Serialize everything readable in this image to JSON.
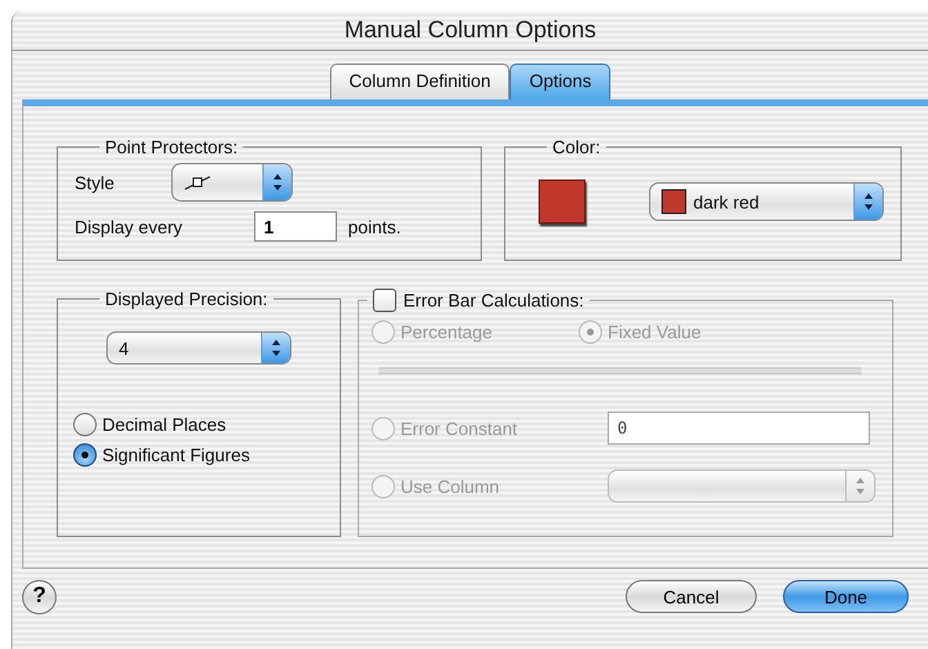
{
  "window": {
    "title": "Manual Column Options"
  },
  "tabs": [
    {
      "label": "Column Definition",
      "selected": false
    },
    {
      "label": "Options",
      "selected": true
    }
  ],
  "point_protectors": {
    "title": "Point Protectors:",
    "style_label": "Style",
    "display_label": "Display every",
    "display_value": "1",
    "units": "points."
  },
  "color": {
    "title": "Color:",
    "color": "#c0382b",
    "popup_value": "dark red"
  },
  "precision": {
    "title": "Displayed Precision:",
    "value": "4",
    "options": [
      {
        "label": "Decimal Places",
        "selected": false
      },
      {
        "label": "Significant Figures",
        "selected": true
      }
    ]
  },
  "error_bars": {
    "title": "Error Bar Calculations:",
    "checked": false,
    "disabled": true,
    "methods": [
      {
        "label": "Percentage",
        "selected": false
      },
      {
        "label": "Fixed Value",
        "selected": true
      }
    ],
    "sources": [
      {
        "kind": "field",
        "label": "Error Constant",
        "selected": false,
        "value": "0"
      },
      {
        "kind": "popup",
        "label": "Use Column",
        "selected": false
      }
    ]
  },
  "buttons": [
    {
      "kind": "help",
      "label": "?"
    },
    {
      "kind": "normal",
      "label": "Cancel"
    },
    {
      "kind": "default",
      "label": "Done"
    }
  ]
}
